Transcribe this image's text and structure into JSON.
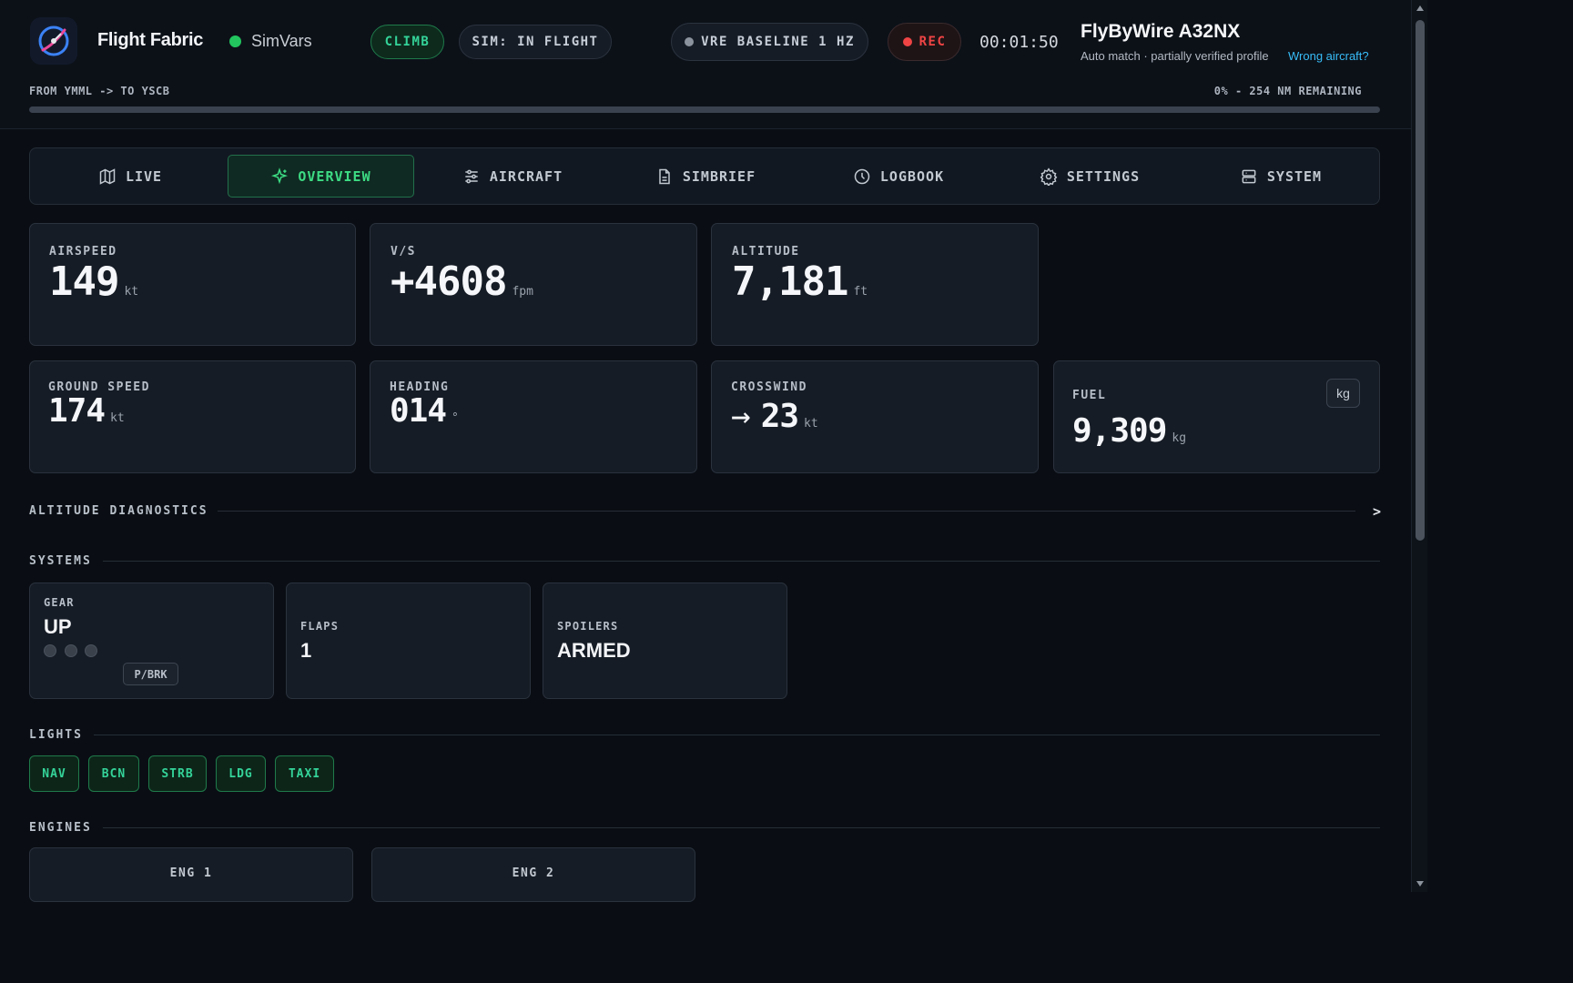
{
  "app": {
    "title": "Flight Fabric",
    "data_source": "SimVars",
    "accent_color": "#22c55e"
  },
  "header": {
    "phase": "CLIMB",
    "sim_status": "SIM: IN FLIGHT",
    "vre": "VRE BASELINE 1 HZ",
    "rec": "REC",
    "timer": "00:01:50",
    "aircraft_name": "FlyByWire A32NX",
    "aircraft_match": "Auto match · partially verified profile",
    "wrong_aircraft_link": "Wrong aircraft?",
    "route": "FROM YMML -> TO YSCB",
    "remaining": "0% - 254 NM REMAINING",
    "progress_percent": 0
  },
  "tabs": [
    {
      "label": "LIVE",
      "icon": "map-icon"
    },
    {
      "label": "OVERVIEW",
      "icon": "sparkle-icon",
      "active": true
    },
    {
      "label": "AIRCRAFT",
      "icon": "sliders-icon"
    },
    {
      "label": "SIMBRIEF",
      "icon": "document-icon"
    },
    {
      "label": "LOGBOOK",
      "icon": "clock-icon"
    },
    {
      "label": "SETTINGS",
      "icon": "gear-icon"
    },
    {
      "label": "SYSTEM",
      "icon": "server-icon"
    }
  ],
  "metrics": {
    "airspeed": {
      "label": "AIRSPEED",
      "value": "149",
      "unit": "kt"
    },
    "vs": {
      "label": "V/S",
      "value": "+4608",
      "unit": "fpm"
    },
    "altitude": {
      "label": "ALTITUDE",
      "value": "7,181",
      "unit": "ft"
    },
    "ground_speed": {
      "label": "GROUND SPEED",
      "value": "174",
      "unit": "kt"
    },
    "heading": {
      "label": "HEADING",
      "value": "014",
      "unit": "°"
    },
    "crosswind": {
      "label": "CROSSWIND",
      "value": "23",
      "unit": "kt",
      "arrow": "→"
    },
    "fuel": {
      "label": "FUEL",
      "value": "9,309",
      "unit": "kg",
      "unit_button": "kg"
    }
  },
  "sections": {
    "altitude_diagnostics": "ALTITUDE DIAGNOSTICS",
    "altitude_diagnostics_toggle": ">",
    "systems": "SYSTEMS",
    "lights": "LIGHTS",
    "engines": "ENGINES"
  },
  "systems": {
    "gear": {
      "label": "GEAR",
      "value": "UP",
      "parking_brake": "P/BRK"
    },
    "flaps": {
      "label": "FLAPS",
      "value": "1"
    },
    "spoilers": {
      "label": "SPOILERS",
      "value": "ARMED"
    }
  },
  "lights": [
    "NAV",
    "BCN",
    "STRB",
    "LDG",
    "TAXI"
  ],
  "engines": [
    {
      "label": "ENG 1"
    },
    {
      "label": "ENG 2"
    }
  ]
}
